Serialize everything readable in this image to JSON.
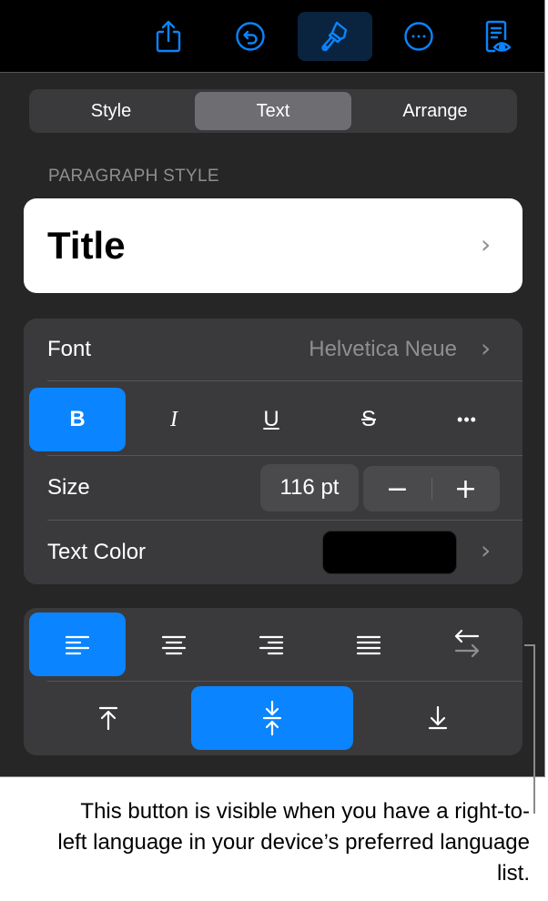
{
  "toolbar": {
    "buttons": [
      {
        "name": "share",
        "icon": "share-icon"
      },
      {
        "name": "undo",
        "icon": "undo-icon"
      },
      {
        "name": "format",
        "icon": "paintbrush-icon",
        "active": true
      },
      {
        "name": "more",
        "icon": "ellipsis-circle-icon"
      },
      {
        "name": "reading-view",
        "icon": "document-eye-icon"
      }
    ],
    "accent": "#0a84ff"
  },
  "tabs": [
    {
      "label": "Style",
      "active": false
    },
    {
      "label": "Text",
      "active": true
    },
    {
      "label": "Arrange",
      "active": false
    }
  ],
  "paragraph_style": {
    "section_label": "PARAGRAPH STYLE",
    "value": "Title"
  },
  "font": {
    "label": "Font",
    "value": "Helvetica Neue"
  },
  "format_buttons": [
    {
      "label": "B",
      "name": "bold",
      "active": true
    },
    {
      "label": "I",
      "name": "italic",
      "active": false
    },
    {
      "label": "U",
      "name": "underline",
      "active": false
    },
    {
      "label": "S",
      "name": "strikethrough",
      "active": false
    },
    {
      "label": "•••",
      "name": "more-text-options",
      "active": false
    }
  ],
  "size": {
    "label": "Size",
    "value": "116 pt",
    "decrement": "−",
    "increment": "+"
  },
  "text_color": {
    "label": "Text Color",
    "value": "#000000"
  },
  "alignment": {
    "horizontal": [
      {
        "name": "align-left",
        "active": true
      },
      {
        "name": "align-center",
        "active": false
      },
      {
        "name": "align-right",
        "active": false
      },
      {
        "name": "justify",
        "active": false
      },
      {
        "name": "text-direction",
        "active": false
      }
    ],
    "vertical": [
      {
        "name": "align-top",
        "active": false
      },
      {
        "name": "align-middle",
        "active": true
      },
      {
        "name": "align-bottom",
        "active": false
      }
    ]
  },
  "callout": {
    "text": "This button is visible when you have a right-to-left language in your device’s preferred language list."
  }
}
